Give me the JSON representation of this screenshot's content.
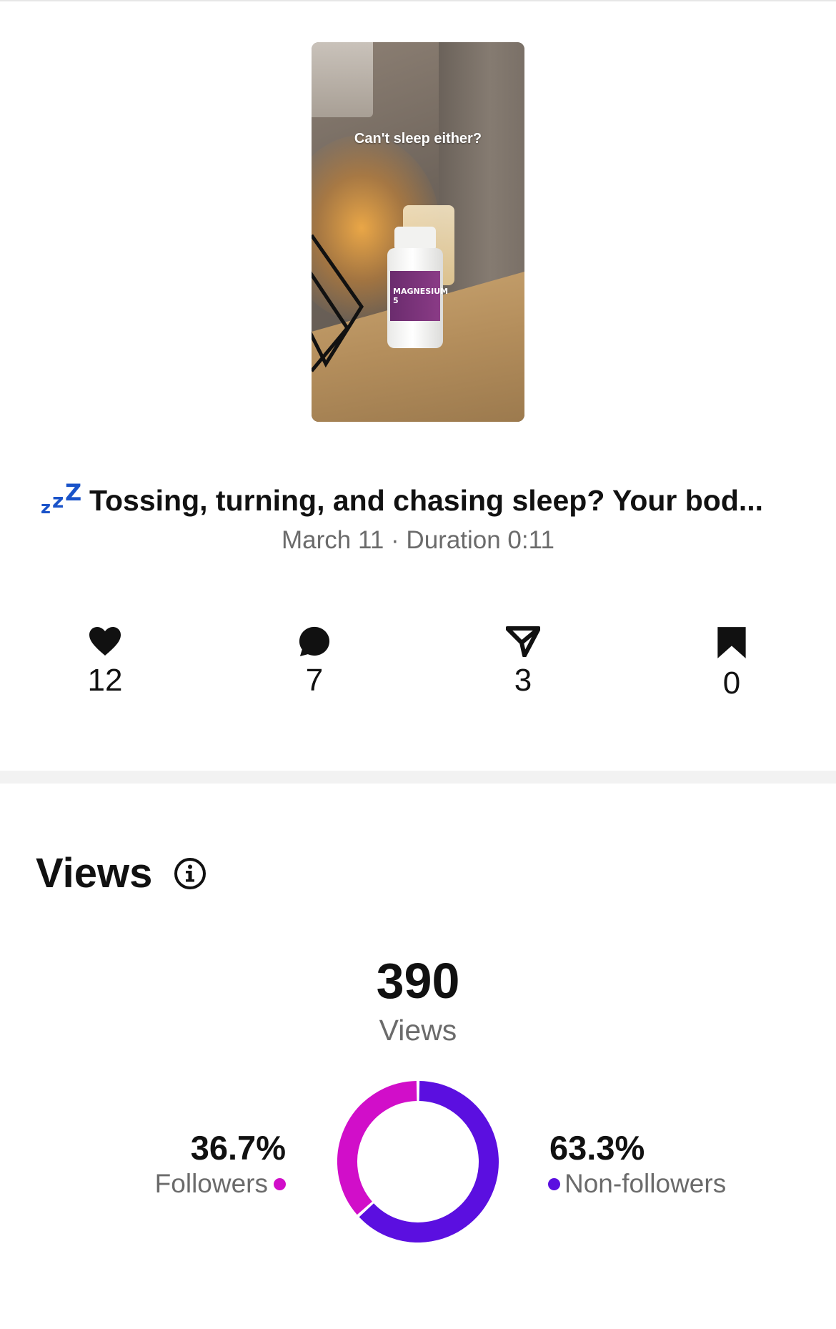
{
  "thumbnail": {
    "caption": "Can't sleep either?",
    "bottle_label": "MAGNESIUM 5"
  },
  "post": {
    "title_icon": "zzz-icon",
    "title": "Tossing, turning, and chasing sleep? Your bod...",
    "meta": "March 11 · Duration 0:11"
  },
  "stats": {
    "likes": {
      "icon": "heart-icon",
      "value": "12"
    },
    "comments": {
      "icon": "comment-icon",
      "value": "7"
    },
    "shares": {
      "icon": "send-icon",
      "value": "3"
    },
    "saves": {
      "icon": "bookmark-icon",
      "value": "0"
    }
  },
  "views": {
    "section_title": "Views",
    "total": "390",
    "total_label": "Views",
    "followers": {
      "percent": "36.7%",
      "label": "Followers",
      "color": "#d10ec9"
    },
    "non_followers": {
      "percent": "63.3%",
      "label": "Non-followers",
      "color": "#5b0fe0"
    }
  },
  "chart_data": {
    "type": "pie",
    "categories": [
      "Followers",
      "Non-followers"
    ],
    "values": [
      36.7,
      63.3
    ],
    "colors": [
      "#d10ec9",
      "#5b0fe0"
    ]
  }
}
